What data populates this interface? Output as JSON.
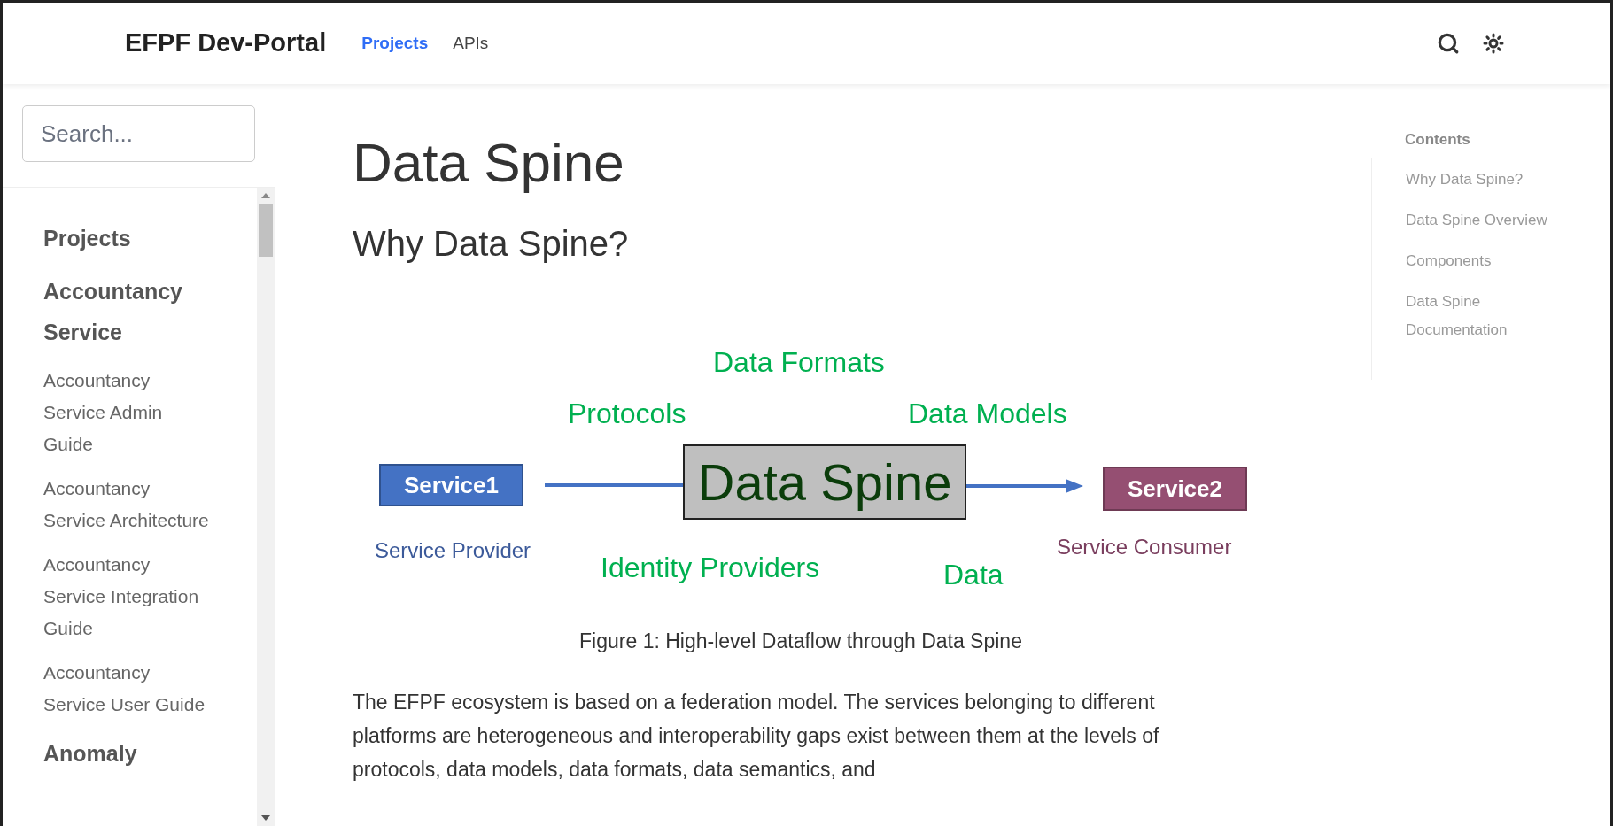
{
  "header": {
    "logo": "EFPF Dev-Portal",
    "nav": [
      {
        "label": "Projects",
        "selected": true
      },
      {
        "label": "APIs",
        "selected": false
      }
    ]
  },
  "sidebar": {
    "search": {
      "placeholder": "Search..."
    },
    "items": [
      {
        "label": "Projects",
        "kind": "heading"
      },
      {
        "label": "Accountancy Service",
        "kind": "heading"
      },
      {
        "label": "Accountancy Service Admin Guide",
        "kind": "link"
      },
      {
        "label": "Accountancy Service Architecture",
        "kind": "link"
      },
      {
        "label": "Accountancy Service Integration Guide",
        "kind": "link"
      },
      {
        "label": "Accountancy Service User Guide",
        "kind": "link"
      },
      {
        "label": "Anomaly",
        "kind": "heading"
      }
    ]
  },
  "main": {
    "title": "Data Spine",
    "subtitle": "Why Data Spine?",
    "figure": {
      "labels": [
        "Data Formats",
        "Protocols",
        "Data Models",
        "Identity Providers",
        "Data"
      ],
      "source": {
        "label": "Service1",
        "caption": "Service Provider"
      },
      "hub": "Data Spine",
      "target": {
        "label": "Service2",
        "caption": "Service Consumer"
      }
    },
    "caption": "Figure 1: High-level Dataflow through Data Spine",
    "paragraph": "The EFPF ecosystem is based on a federation model. The services belonging to different platforms are heterogeneous and interoperability gaps exist between them at the levels of protocols, data models, data formats, data semantics, and"
  },
  "toc": {
    "title": "Contents",
    "items": [
      "Why Data Spine?",
      "Data Spine Overview",
      "Components",
      "Data Spine Documentation"
    ]
  }
}
